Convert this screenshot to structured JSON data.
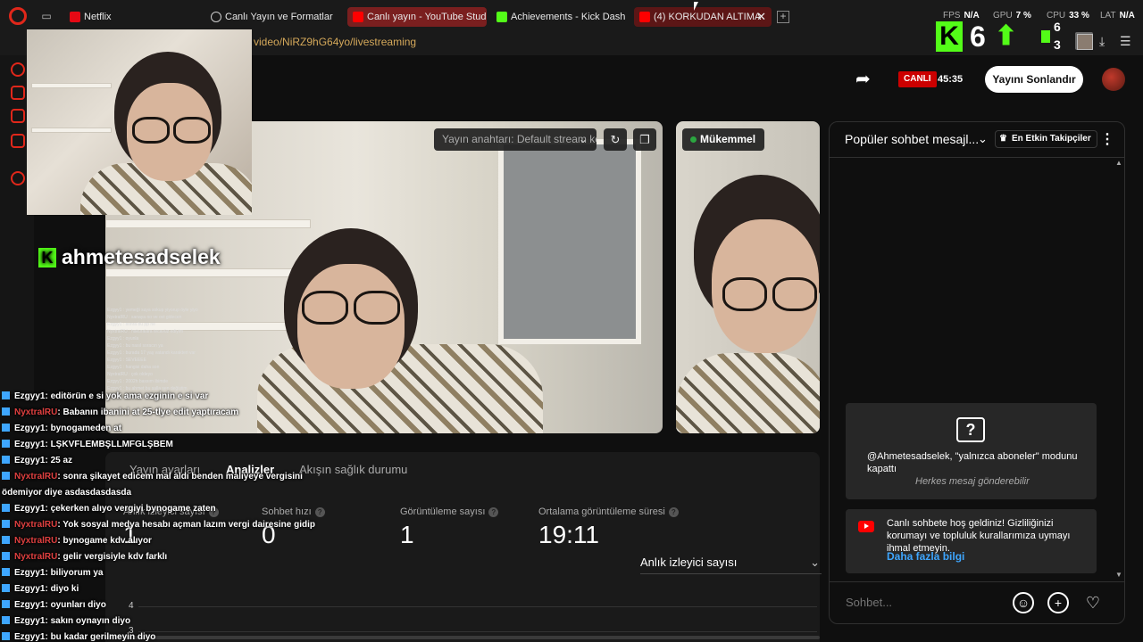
{
  "browser": {
    "tabs": [
      {
        "label": "Netflix"
      },
      {
        "label": "Canlı Yayın ve Formatlar"
      },
      {
        "label": "Canlı yayın - YouTube Stud"
      },
      {
        "label": "Achievements - Kick Dash"
      },
      {
        "label": "(4) KORKUDAN ALTIMA"
      }
    ],
    "new_tab": "+",
    "url": "video/NiRZ9hG64yo/livestreaming",
    "stats": {
      "fps_label": "FPS",
      "fps_value": "N/A",
      "gpu_label": "GPU",
      "gpu_value": "7 %",
      "cpu_label": "CPU",
      "cpu_value": "33 %",
      "lat_label": "LAT",
      "lat_value": "N/A"
    }
  },
  "kick_overlay": {
    "logo": "K",
    "count_big": "6",
    "count_small_top": "6",
    "count_small_bottom": "3",
    "channel_name": "ahmetesadselek"
  },
  "studio_header": {
    "live_label": "CANLI",
    "live_time": "45:35",
    "end_stream_label": "Yayını Sonlandır"
  },
  "preview": {
    "stream_key_label": "Yayın anahtarı: Default stream key",
    "quality_label": "Mükemmel"
  },
  "tabs": {
    "settings": "Yayın ayarları",
    "analytics": "Analizler",
    "health": "Akışın sağlık durumu"
  },
  "metrics": [
    {
      "label": "Anlık izleyici sayısı",
      "value": "1"
    },
    {
      "label": "Sohbet hızı",
      "value": "0"
    },
    {
      "label": "Görüntüleme sayısı",
      "value": "1"
    },
    {
      "label": "Ortalama görüntüleme süresi",
      "value": "19:11"
    }
  ],
  "graph": {
    "selector_label": "Anlık izleyici sayısı",
    "tick_4": "4",
    "tick_3": "3"
  },
  "kick_chat": [
    {
      "user": "Ezgyy1",
      "text": ": editörün e si yok ama ezginin e si var",
      "color": "white"
    },
    {
      "user": "NyxtralRU",
      "text": ": Babanın ibanini at 25-tlye edit yaptıracam",
      "color": "red"
    },
    {
      "user": "Ezgyy1",
      "text": ": bynogameden at",
      "color": "white"
    },
    {
      "user": "Ezgyy1",
      "text": ": LŞKVFLEMBŞLLMFGLŞBEM",
      "color": "white"
    },
    {
      "user": "Ezgyy1",
      "text": ": 25 az",
      "color": "white"
    },
    {
      "user": "NyxtralRU",
      "text": ": sonra şikayet edicem mal aldı benden maliyeye vergisini",
      "color": "red"
    },
    {
      "user": "",
      "text": "ödemiyor diye asdasdasdasda",
      "color": "white"
    },
    {
      "user": "Ezgyy1",
      "text": ": çekerken alıyo vergiyi bynogame zaten",
      "color": "white"
    },
    {
      "user": "NyxtralRU",
      "text": ": Yok sosyal medya hesabı açman lazım vergi dairesine gidip",
      "color": "red"
    },
    {
      "user": "NyxtralRU",
      "text": ": bynogame kdv alıyor",
      "color": "red"
    },
    {
      "user": "NyxtralRU",
      "text": ": gelir vergisiyle kdv farklı",
      "color": "red"
    },
    {
      "user": "Ezgyy1",
      "text": ": biliyorum ya",
      "color": "white"
    },
    {
      "user": "Ezgyy1",
      "text": ": diyo ki",
      "color": "white"
    },
    {
      "user": "Ezgyy1",
      "text": ": oyunları diyo",
      "color": "white"
    },
    {
      "user": "Ezgyy1",
      "text": ": sakın oynayın diyo",
      "color": "white"
    },
    {
      "user": "Ezgyy1",
      "text": ": bu kadar gerilmeyin diyo",
      "color": "white"
    }
  ],
  "chat": {
    "header": "Popüler sohbet mesajl...",
    "top_fans": "En Etkin Takipçiler",
    "mode_notice": "@Ahmetesadselek, \"yalnızca aboneler\" modunu kapattı",
    "mode_sub": "Herkes mesaj gönderebilir",
    "welcome": "Canlı sohbete hoş geldiniz! Gizliliğinizi korumayı ve topluluk kurallarımıza uymayı ihmal etmeyin.",
    "learn_more": "Daha fazla bilgi",
    "input_placeholder": "Sohbet..."
  },
  "colors": {
    "accent_red": "#cc0000",
    "kick_green": "#53fc18",
    "link_blue": "#3ea6ff"
  }
}
